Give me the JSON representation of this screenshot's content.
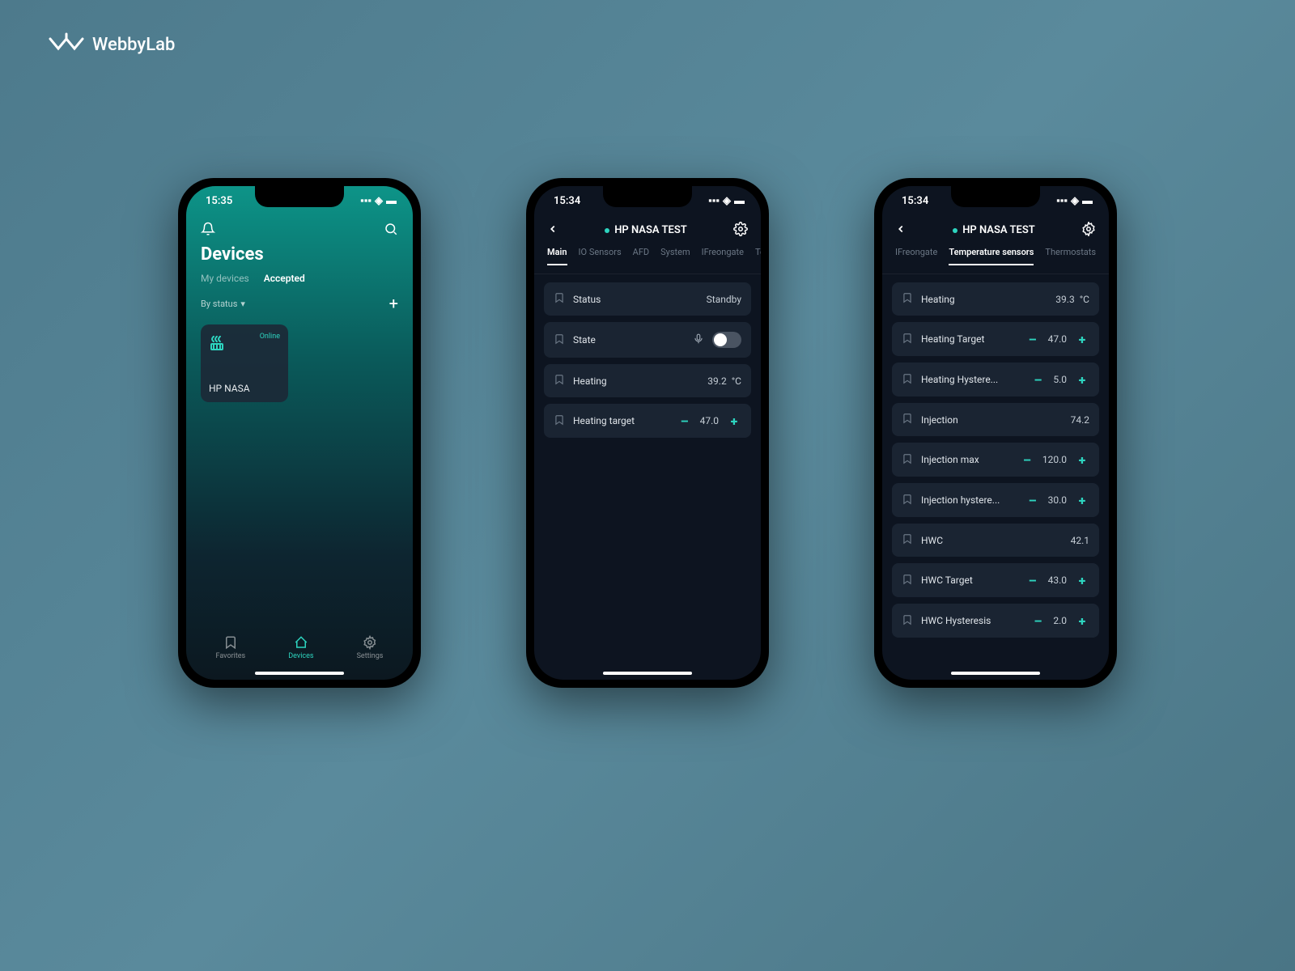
{
  "brand": "WebbyLab",
  "phone1": {
    "time": "15:35",
    "title": "Devices",
    "subTabs": {
      "my": "My devices",
      "accepted": "Accepted"
    },
    "filter": "By status",
    "device": {
      "name": "HP NASA",
      "status": "Online"
    },
    "nav": {
      "favorites": "Favorites",
      "devices": "Devices",
      "settings": "Settings"
    }
  },
  "phone2": {
    "time": "15:34",
    "title": "HP NASA TEST",
    "tabs": [
      "Main",
      "IO Sensors",
      "AFD",
      "System",
      "IFreongate",
      "Te"
    ],
    "activeTab": 0,
    "rows": {
      "status": {
        "label": "Status",
        "value": "Standby"
      },
      "state": {
        "label": "State"
      },
      "heating": {
        "label": "Heating",
        "value": "39.2",
        "unit": "°C"
      },
      "heatingTarget": {
        "label": "Heating target",
        "value": "47.0"
      }
    }
  },
  "phone3": {
    "time": "15:34",
    "title": "HP NASA TEST",
    "tabs": [
      "IFreongate",
      "Temperature sensors",
      "Thermostats"
    ],
    "activeTab": 1,
    "rows": {
      "r0": {
        "label": "Heating",
        "value": "39.3",
        "unit": "°C"
      },
      "r1": {
        "label": "Heating Target",
        "value": "47.0"
      },
      "r2": {
        "label": "Heating Hystere...",
        "value": "5.0"
      },
      "r3": {
        "label": "Injection",
        "value": "74.2"
      },
      "r4": {
        "label": "Injection max",
        "value": "120.0"
      },
      "r5": {
        "label": "Injection hystere...",
        "value": "30.0"
      },
      "r6": {
        "label": "HWC",
        "value": "42.1"
      },
      "r7": {
        "label": "HWC Target",
        "value": "43.0"
      },
      "r8": {
        "label": "HWC Hysteresis",
        "value": "2.0"
      }
    }
  }
}
